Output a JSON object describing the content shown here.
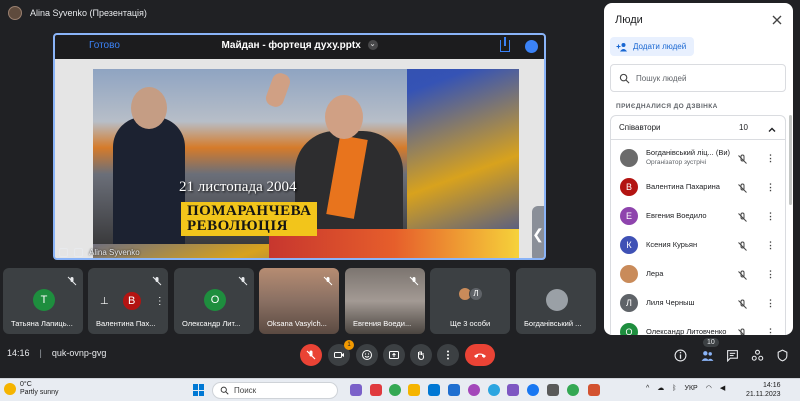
{
  "window": {
    "presenter_title": "Alina Syvenko (Презентація)"
  },
  "presentation": {
    "done_label": "Готово",
    "file_title": "Майдан - фортеця духу.pptx",
    "slide_date": "21 листопада 2004",
    "banner_line1": "ПОМАРАНЧЕВА",
    "banner_line2": "РЕВОЛЮЦІЯ",
    "self_name": "Alina Syvenko",
    "side_handle": "❮"
  },
  "participants_strip": [
    {
      "name": "Татьяна Лапиць...",
      "avatar_letter": "Т",
      "avatar_color": "#1e8e3e"
    },
    {
      "name": "Валентина Пах...",
      "avatar_letter": "В",
      "avatar_color": "#b31412"
    },
    {
      "name": "Олександр Лит...",
      "avatar_letter": "О",
      "avatar_color": "#1e8e3e"
    },
    {
      "name": "Oksana Vasylch..."
    },
    {
      "name": "Евгения Воеди..."
    },
    {
      "name": "Ще 3 особи",
      "stack": [
        "Л"
      ]
    },
    {
      "name": "Богданівський ..."
    }
  ],
  "controls": {
    "meeting_time": "14:16",
    "separator": "|",
    "meeting_code": "quk-ovnp-gvg",
    "raise_badge": "1",
    "participant_count": "10"
  },
  "panel": {
    "title": "Люди",
    "add_people": "Додати людей",
    "search_placeholder": "Пошук людей",
    "section_label": "ПРИЄДНАЛИСЯ ДО ДЗВІНКА",
    "group_label": "Співавтори",
    "group_count": "10",
    "people": [
      {
        "name": "Богданівський ліц... (Ви)",
        "role": "Організатор зустрічі",
        "avatar_letter": "",
        "avatar_color": "#6b6b6b"
      },
      {
        "name": "Валентина Пахарина",
        "avatar_letter": "В",
        "avatar_color": "#b31412"
      },
      {
        "name": "Евгения Воедило",
        "avatar_letter": "Е",
        "avatar_color": "#8e44ad"
      },
      {
        "name": "Ксения Курьян",
        "avatar_letter": "К",
        "avatar_color": "#3f51b5"
      },
      {
        "name": "Лера",
        "avatar_letter": "",
        "avatar_color": "#c98b5a"
      },
      {
        "name": "Лиля Черныш",
        "avatar_letter": "Л",
        "avatar_color": "#5f6368"
      },
      {
        "name": "Олександр Литовченко",
        "avatar_letter": "О",
        "avatar_color": "#1e8e3e"
      }
    ]
  },
  "taskbar": {
    "temp": "0°C",
    "weather": "Partly sunny",
    "search_placeholder": "Поиск",
    "lang": "УКР",
    "time": "14:16",
    "date": "21.11.2023"
  },
  "colors": {
    "accent": "#8ab4f8",
    "end_call": "#ea4335",
    "add_btn_text": "#1967d2"
  }
}
